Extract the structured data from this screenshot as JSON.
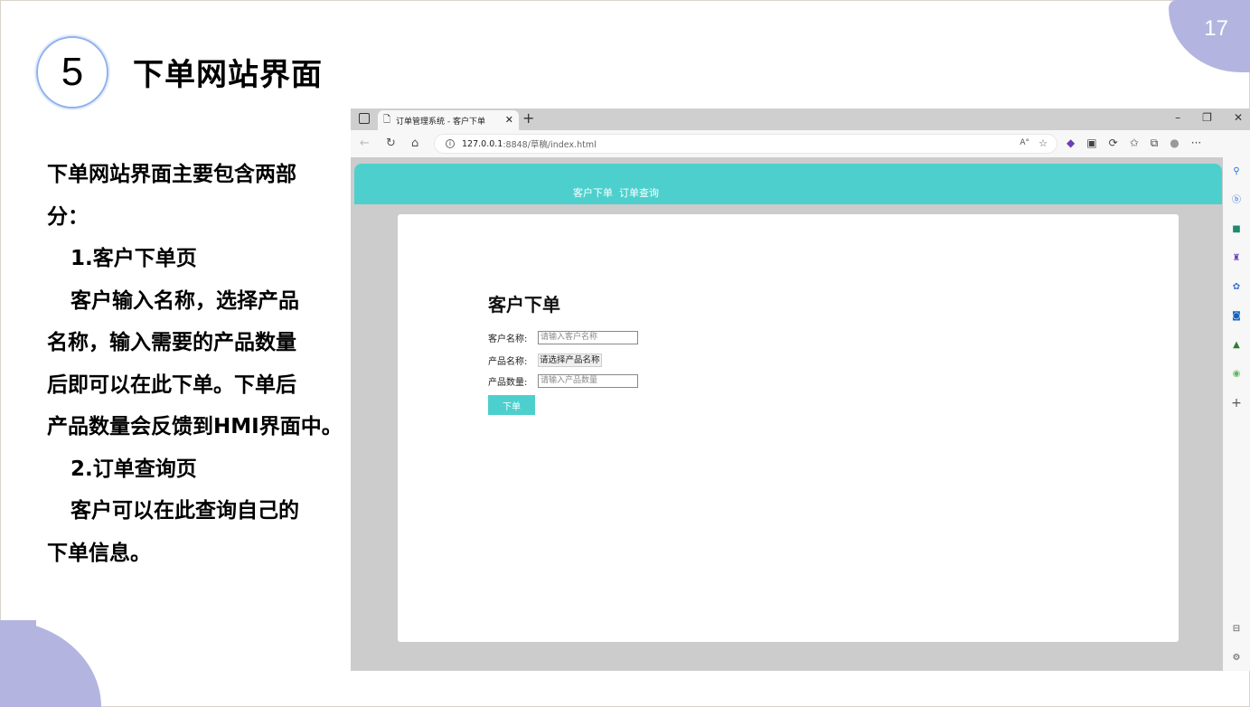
{
  "slide": {
    "page_number": "17",
    "section_number": "5",
    "title": "下单网站界面",
    "description": [
      "下单网站界面主要包含两部",
      "分：",
      "1.客户下单页",
      "客户输入名称，选择产品",
      "名称，输入需要的产品数量",
      "后即可以在此下单。下单后",
      "产品数量会反馈到HMI界面中。",
      "2.订单查询页",
      "客户可以在此查询自己的",
      "下单信息。"
    ],
    "accent_color": "#b3b5e0"
  },
  "browser": {
    "tab_title": "订单管理系统 - 客户下单",
    "url_host": "127.0.0.1",
    "url_path": ":8848/草稿/index.html",
    "icons": [
      "tab-actions-icon",
      "page-icon",
      "close-icon",
      "new-tab-icon",
      "minimize-icon",
      "restore-icon",
      "window-close-icon",
      "back-icon",
      "refresh-icon",
      "home-icon",
      "info-icon",
      "read-aloud-icon",
      "favorite-icon",
      "extensions-icon",
      "favorites-icon",
      "collections-icon",
      "profile-icon",
      "more-icon",
      "search-icon",
      "copilot-icon",
      "shopping-icon",
      "games-icon",
      "office-icon",
      "outlook-icon",
      "tree-icon",
      "add-icon",
      "sidebar-toggle-icon",
      "settings-icon"
    ]
  },
  "app": {
    "nav": [
      "客户下单",
      "订单查询"
    ],
    "header_color": "#4dd0cd",
    "form": {
      "title": "客户下单",
      "customer_label": "客户名称:",
      "customer_placeholder": "请输入客户名称",
      "product_label": "产品名称:",
      "product_select": "请选择产品名称",
      "quantity_label": "产品数量:",
      "quantity_placeholder": "请输入产品数量",
      "submit": "下单"
    }
  }
}
